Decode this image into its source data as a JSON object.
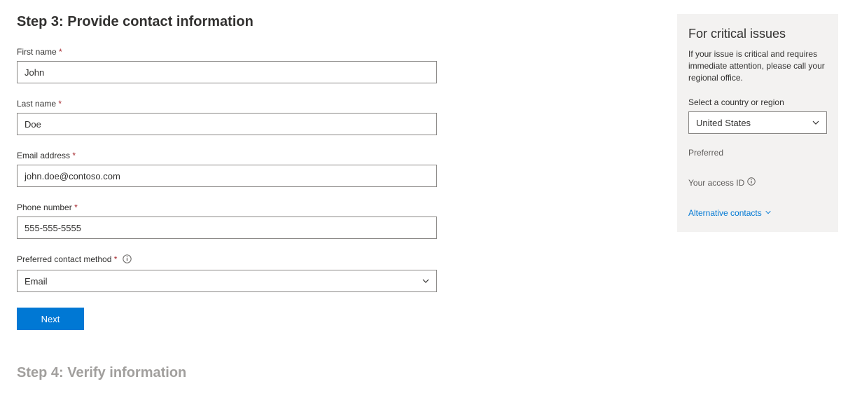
{
  "step3": {
    "title": "Step 3: Provide contact information",
    "firstName": {
      "label": "First name",
      "value": "John"
    },
    "lastName": {
      "label": "Last name",
      "value": "Doe"
    },
    "email": {
      "label": "Email address",
      "value": "john.doe@contoso.com"
    },
    "phone": {
      "label": "Phone number",
      "value": "555-555-5555"
    },
    "contactMethod": {
      "label": "Preferred contact method",
      "value": "Email"
    },
    "nextButton": "Next"
  },
  "step4": {
    "title": "Step 4: Verify information"
  },
  "sidebar": {
    "title": "For critical issues",
    "text": "If your issue is critical and requires immediate attention, please call your regional office.",
    "countryLabel": "Select a country or region",
    "countryValue": "United States",
    "preferredLabel": "Preferred",
    "accessIdLabel": "Your access ID",
    "altContacts": "Alternative contacts"
  }
}
